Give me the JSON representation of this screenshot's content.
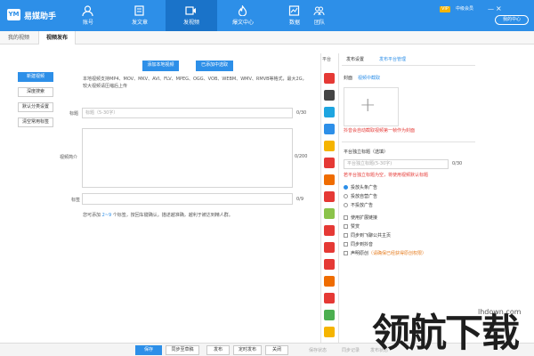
{
  "app": {
    "title": "易媒助手",
    "logo": "YM"
  },
  "nav": [
    {
      "label": "账号",
      "icon": "account-icon"
    },
    {
      "label": "发文章",
      "icon": "article-icon"
    },
    {
      "label": "发视频",
      "icon": "video-icon"
    },
    {
      "label": "爆文中心",
      "icon": "fire-icon"
    },
    {
      "label": "数据",
      "icon": "chart-icon"
    },
    {
      "label": "团队",
      "icon": "team-icon"
    }
  ],
  "header": {
    "vip": "VIP",
    "user": "中级会员",
    "minimize": "—",
    "close": "×",
    "settle": "我的中心"
  },
  "tabs": {
    "my_videos": "我的视频",
    "video_publish": "视频发布"
  },
  "sidebar": {
    "new_video": "新建视频",
    "deep_search": "深度搜索",
    "default_category": "默认分类设置",
    "clear_tags": "清空常用标签"
  },
  "main": {
    "add_local": "添加本地视频",
    "add_folder": "已添加中选取",
    "format_desc": "本地视频支持MP4、MOV、MKV、AVI、FLV、MPEG、OGG、VOB、WEBM、WMV、RMVB等格式，最大2G，较大视频请压缩后上传",
    "title_label": "标题",
    "title_placeholder": "标题（5-30字）",
    "title_count": "0/30",
    "intro_label": "视频简介",
    "intro_count": "0/200",
    "tag_label": "标签",
    "tag_count": "0/9",
    "tag_hint_pre": "您可添加 ",
    "tag_hint_num": "2~9",
    "tag_hint_post": " 个标签，按回车键确认。描述越准确，越利于被达到精人群。"
  },
  "platforms": {
    "title": "平台",
    "items": [
      "#e53935",
      "#444",
      "#1ea5e0",
      "#2d8fe8",
      "#f5b400",
      "#e53935",
      "#ef6c00",
      "#e53935",
      "#8bc34a",
      "#e53935",
      "#e53935",
      "#e53935",
      "#ef6c00",
      "#e53935",
      "#4caf50",
      "#f5b400"
    ]
  },
  "right": {
    "tab_settings": "发布设置",
    "tab_platform": "发布平台管理",
    "cover_label": "封面",
    "cover_link": "视频中截取",
    "cover_warn": "抖音会自动截取视频第一帧作为封面",
    "ptitle_label": "平台独立标题（选填）",
    "ptitle_placeholder": "平台独立标题(5-30字)",
    "ptitle_count": "0/30",
    "ptitle_warn": "若平台独立标题为空，将使用视频默认标题",
    "radios": [
      "投放头条广告",
      "投放自营广告",
      "不投放广告"
    ],
    "checks": [
      "使用扩展链接",
      "赞赏",
      "同步到飞聊公共主页",
      "同步到抖音"
    ],
    "declare": "声明原创",
    "declare_note": "（请确保已经获得原创权限）"
  },
  "bottom": {
    "save": "保存",
    "sync_draft": "同步至草稿",
    "publish": "发布",
    "scheduled": "定时发布",
    "close": "关闭",
    "g1": "保存状态",
    "g2": "同步记录",
    "g3": "发布状态"
  },
  "watermark": {
    "url": "lhdown.com",
    "text": "领航下载"
  }
}
